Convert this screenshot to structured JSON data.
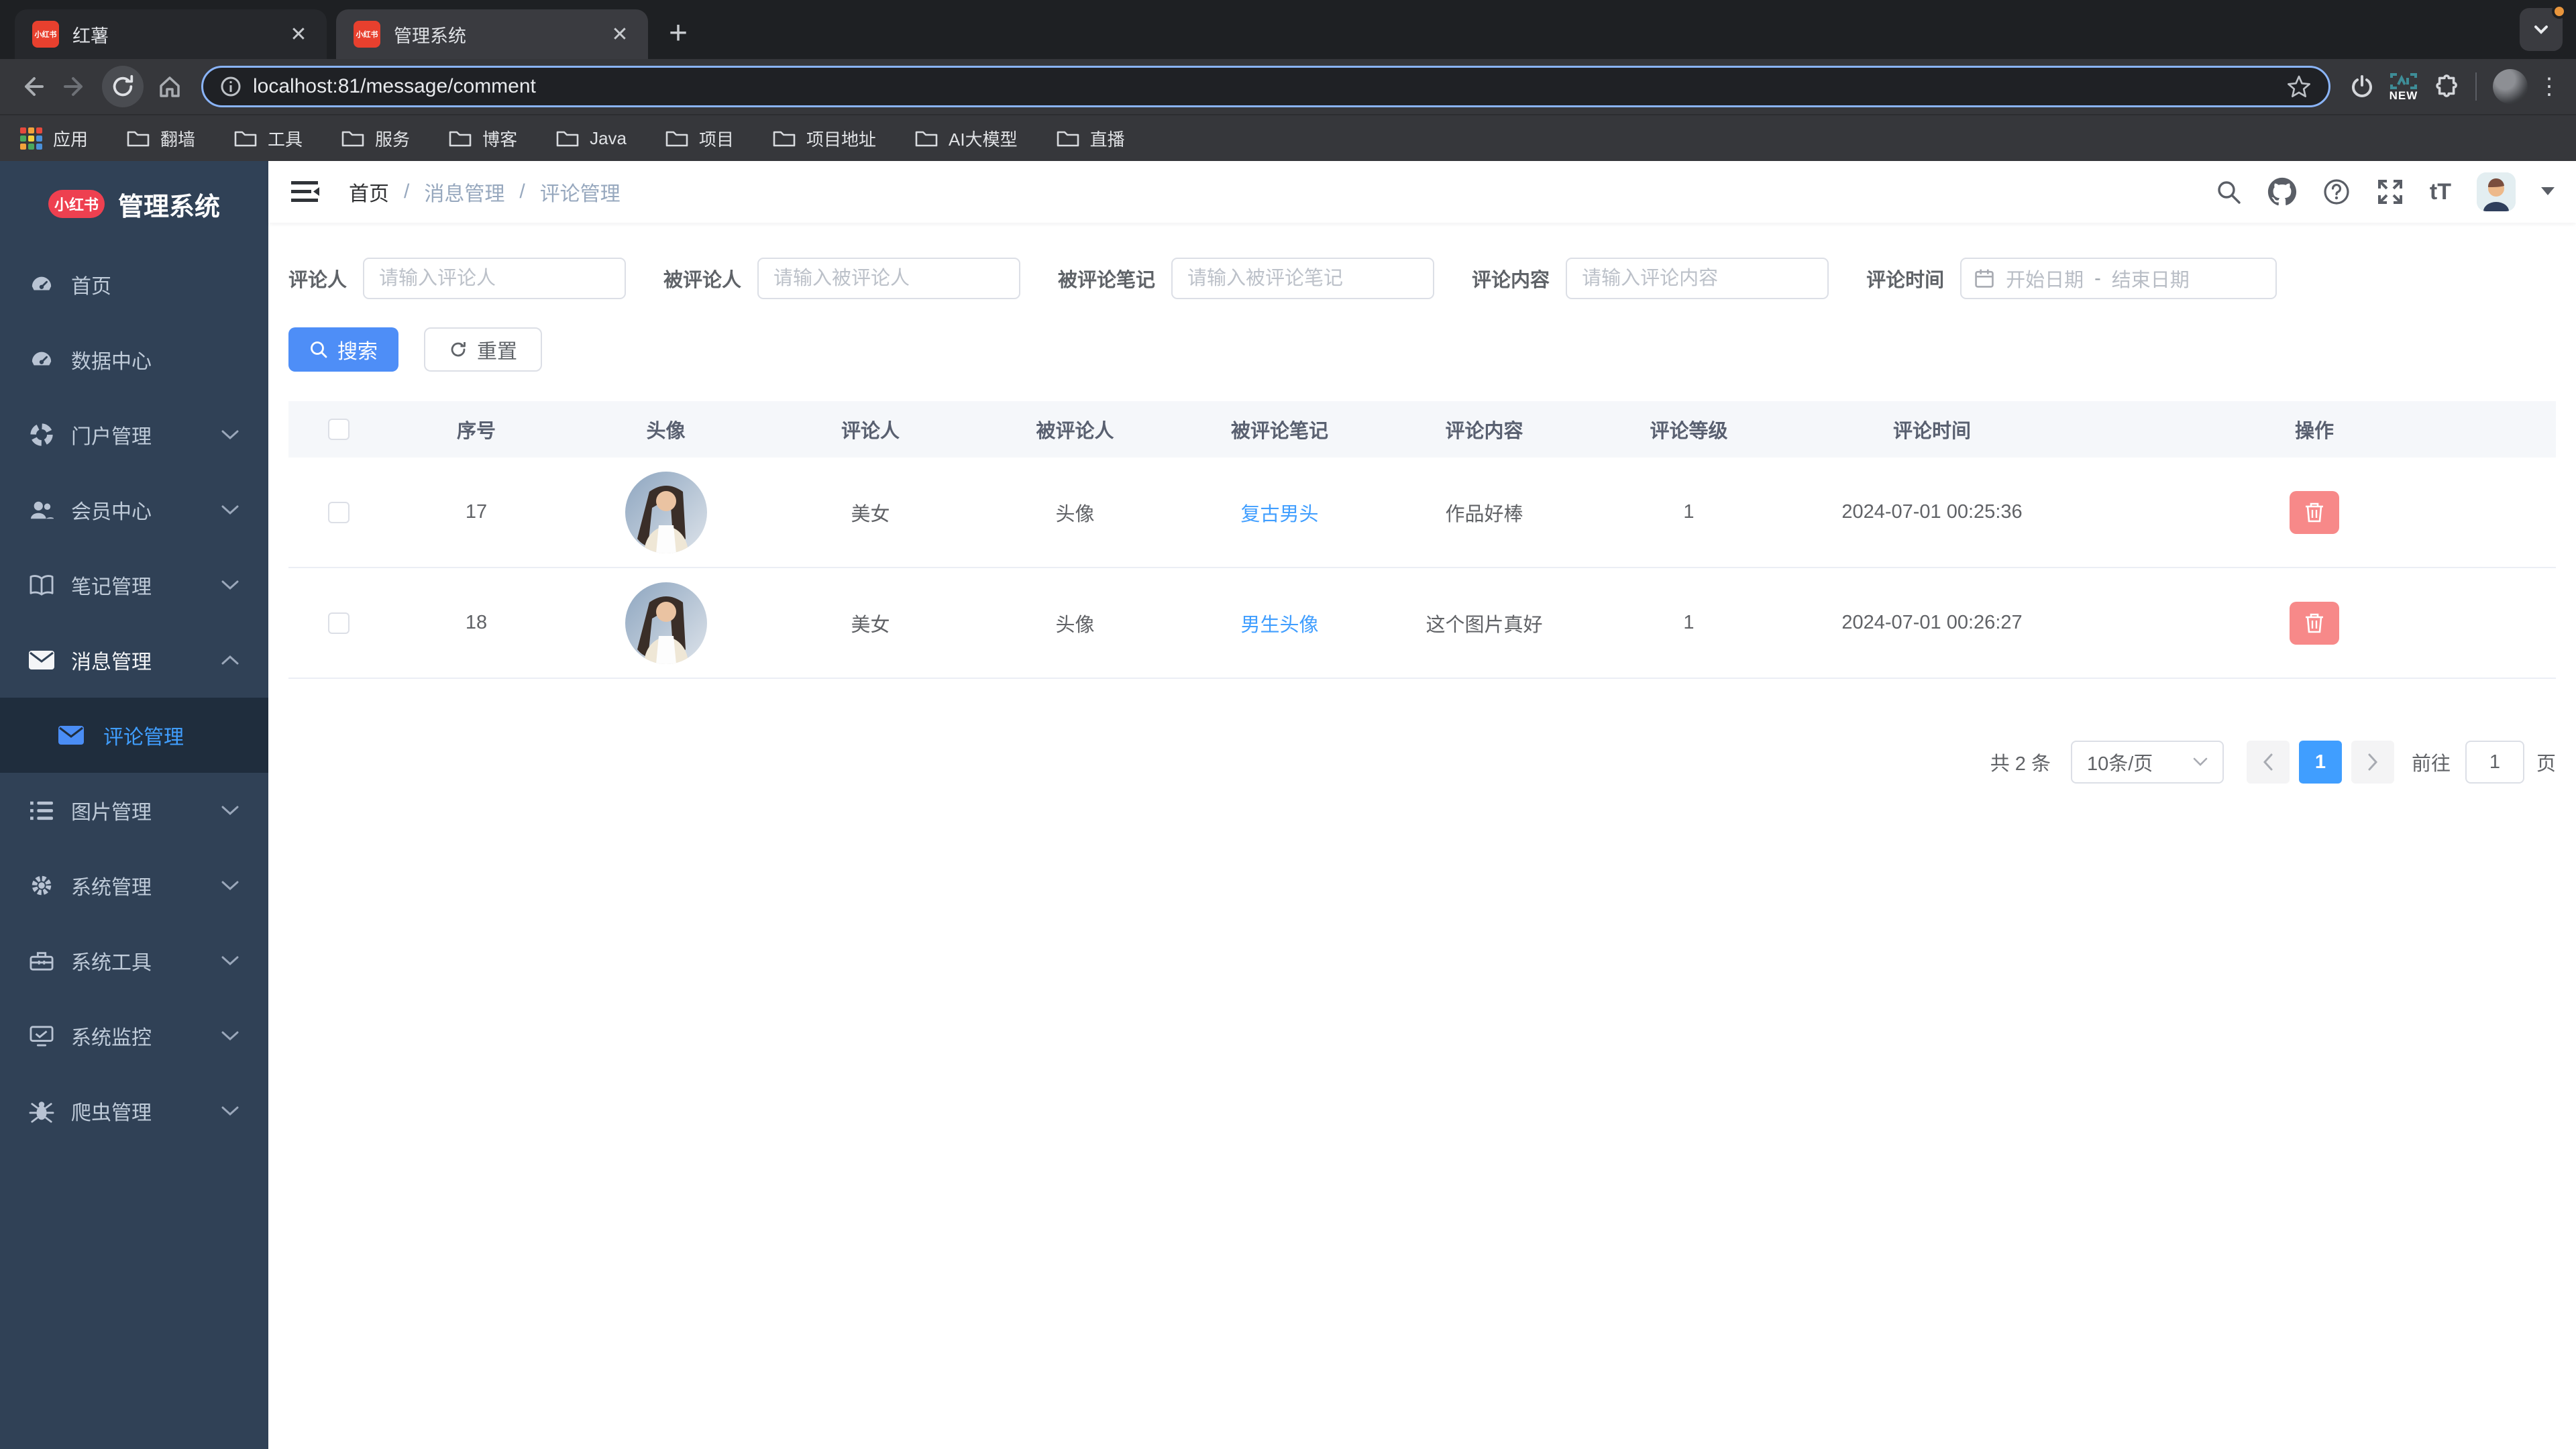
{
  "browser": {
    "tabs": [
      {
        "title": "红薯",
        "favicon": "小红书"
      },
      {
        "title": "管理系统",
        "favicon": "小红书"
      }
    ],
    "url": "localhost:81/message/comment",
    "new_badge": "NEW",
    "bookmarks": [
      "应用",
      "翻墙",
      "工具",
      "服务",
      "博客",
      "Java",
      "项目",
      "项目地址",
      "AI大模型",
      "直播"
    ]
  },
  "sidebar": {
    "logo_badge": "小红书",
    "logo_title": "管理系统",
    "items": [
      {
        "label": "首页",
        "icon": "dashboard-icon"
      },
      {
        "label": "数据中心",
        "icon": "data-center-icon"
      },
      {
        "label": "门户管理",
        "icon": "portal-icon",
        "chevron": "down"
      },
      {
        "label": "会员中心",
        "icon": "members-icon",
        "chevron": "down"
      },
      {
        "label": "笔记管理",
        "icon": "notes-icon",
        "chevron": "down"
      },
      {
        "label": "消息管理",
        "icon": "message-icon",
        "chevron": "up",
        "expanded": true
      },
      {
        "label": "评论管理",
        "icon": "comment-icon",
        "active": true,
        "submenu": true
      },
      {
        "label": "图片管理",
        "icon": "images-icon",
        "chevron": "down"
      },
      {
        "label": "系统管理",
        "icon": "system-icon",
        "chevron": "down"
      },
      {
        "label": "系统工具",
        "icon": "tools-icon",
        "chevron": "down"
      },
      {
        "label": "系统监控",
        "icon": "monitor-icon",
        "chevron": "down"
      },
      {
        "label": "爬虫管理",
        "icon": "spider-icon",
        "chevron": "down"
      }
    ]
  },
  "breadcrumb": {
    "items": [
      "首页",
      "消息管理",
      "评论管理"
    ]
  },
  "header": {
    "text_size_label": "tT"
  },
  "filters": [
    {
      "label": "评论人",
      "placeholder": "请输入评论人"
    },
    {
      "label": "被评论人",
      "placeholder": "请输入被评论人"
    },
    {
      "label": "被评论笔记",
      "placeholder": "请输入被评论笔记"
    },
    {
      "label": "评论内容",
      "placeholder": "请输入评论内容"
    },
    {
      "label": "评论时间",
      "start_placeholder": "开始日期",
      "separator": "-",
      "end_placeholder": "结束日期"
    }
  ],
  "actions": {
    "search": "搜索",
    "reset": "重置"
  },
  "table": {
    "headers": [
      "序号",
      "头像",
      "评论人",
      "被评论人",
      "被评论笔记",
      "评论内容",
      "评论等级",
      "评论时间",
      "操作"
    ],
    "rows": [
      {
        "seq": "17",
        "commenter": "美女",
        "commentee": "头像",
        "note": "复古男头",
        "content": "作品好棒",
        "level": "1",
        "time": "2024-07-01 00:25:36"
      },
      {
        "seq": "18",
        "commenter": "美女",
        "commentee": "头像",
        "note": "男生头像",
        "content": "这个图片真好",
        "level": "1",
        "time": "2024-07-01 00:26:27"
      }
    ]
  },
  "pagination": {
    "total": "共 2 条",
    "page_size": "10条/页",
    "current_page": "1",
    "goto_label": "前往",
    "goto_value": "1",
    "goto_unit": "页"
  },
  "colors": {
    "accent": "#409eff",
    "primary_button": "#4e8ef7",
    "danger": "#f78989",
    "sidebar_bg": "#304156",
    "sidebar_active_bg": "#1f2d3d"
  }
}
